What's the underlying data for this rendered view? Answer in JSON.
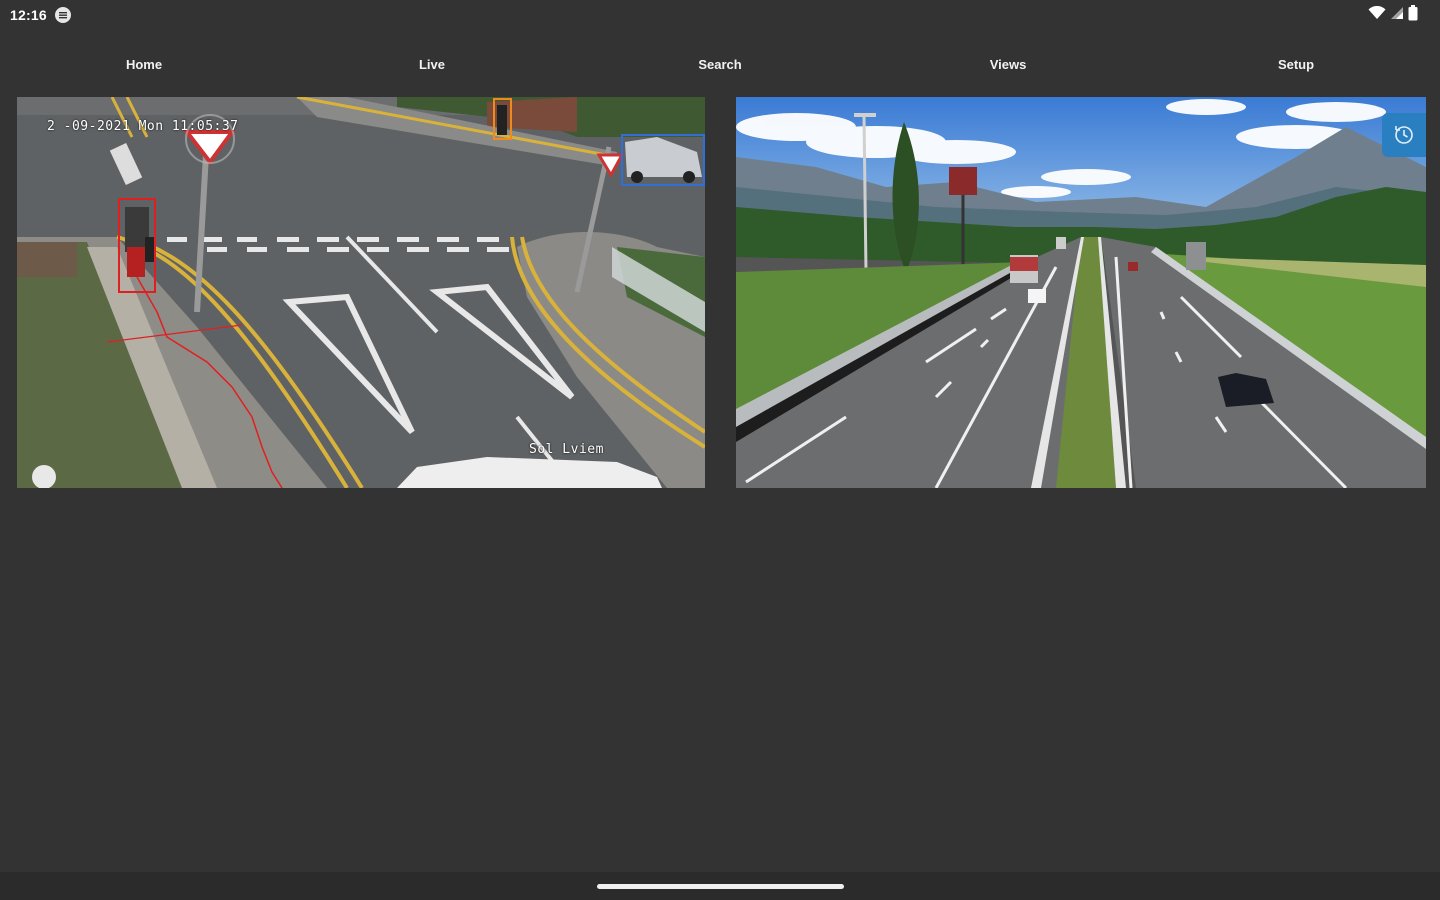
{
  "status_bar": {
    "time": "12:16",
    "app_icon": "notification-app-icon",
    "icons": [
      "wifi-icon",
      "signal-icon",
      "battery-icon"
    ]
  },
  "nav": {
    "tabs": [
      {
        "label": "Home"
      },
      {
        "label": "Live"
      },
      {
        "label": "Search"
      },
      {
        "label": "Views"
      },
      {
        "label": "Setup"
      }
    ]
  },
  "cameras": [
    {
      "overlay_timestamp": "2 -09-2021 Mon 11:05:37",
      "overlay_name": "Sol Lviem"
    },
    {
      "ptz_icon": "ptz-control-icon"
    }
  ],
  "colors": {
    "background": "#333333",
    "accent": "#2a7fc1",
    "person_box": "#e02020",
    "vehicle_box": "#2f6fd6",
    "object_box": "#f08a1c"
  }
}
